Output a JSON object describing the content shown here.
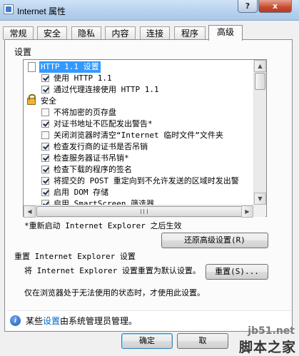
{
  "window": {
    "title": "Internet 属性",
    "help_label": "?",
    "close_label": "x"
  },
  "tabs": [
    {
      "label": "常规"
    },
    {
      "label": "安全"
    },
    {
      "label": "隐私"
    },
    {
      "label": "内容"
    },
    {
      "label": "连接"
    },
    {
      "label": "程序"
    },
    {
      "label": "高级",
      "active": true
    }
  ],
  "settings": {
    "group_label": "设置",
    "tree": [
      {
        "label": "HTTP 1.1 设置",
        "type": "category",
        "icon": "page-icon"
      },
      {
        "label": "使用 HTTP 1.1",
        "type": "checkbox",
        "checked": true
      },
      {
        "label": "通过代理连接使用 HTTP 1.1",
        "type": "checkbox",
        "checked": true
      },
      {
        "label": "安全",
        "type": "category",
        "icon": "lock-icon"
      },
      {
        "label": "不将加密的页存盘",
        "type": "checkbox",
        "checked": false
      },
      {
        "label": "对证书地址不匹配发出警告*",
        "type": "checkbox",
        "checked": true
      },
      {
        "label": "关闭浏览器时清空“Internet 临时文件”文件夹",
        "type": "checkbox",
        "checked": false
      },
      {
        "label": "检查发行商的证书是否吊销",
        "type": "checkbox",
        "checked": true
      },
      {
        "label": "检查服务器证书吊销*",
        "type": "checkbox",
        "checked": true
      },
      {
        "label": "检查下载的程序的签名",
        "type": "checkbox",
        "checked": true
      },
      {
        "label": "将提交的 POST 重定向到不允许发送的区域时发出警",
        "type": "checkbox",
        "checked": true
      },
      {
        "label": "启用 DOM 存储",
        "type": "checkbox",
        "checked": true
      },
      {
        "label": "启用 SmartScreen 筛选器",
        "type": "checkbox",
        "checked": true
      }
    ],
    "restart_note": "*重新启动 Internet Explorer 之后生效",
    "restore_button": "还原高级设置(R)"
  },
  "reset": {
    "heading": "重置 Internet Explorer 设置",
    "description": "将 Internet Explorer 设置重置为默认设置。",
    "button": "重置(S)...",
    "note": "仅在浏览器处于无法使用的状态时，才使用此设置。"
  },
  "info": {
    "prefix": "某些",
    "link": "设置",
    "suffix": "由系统管理员管理。"
  },
  "footer": {
    "ok_button": "确定",
    "cancel_button": "取"
  },
  "watermark": {
    "site": "jb51.net",
    "brand": "脚本之家"
  }
}
